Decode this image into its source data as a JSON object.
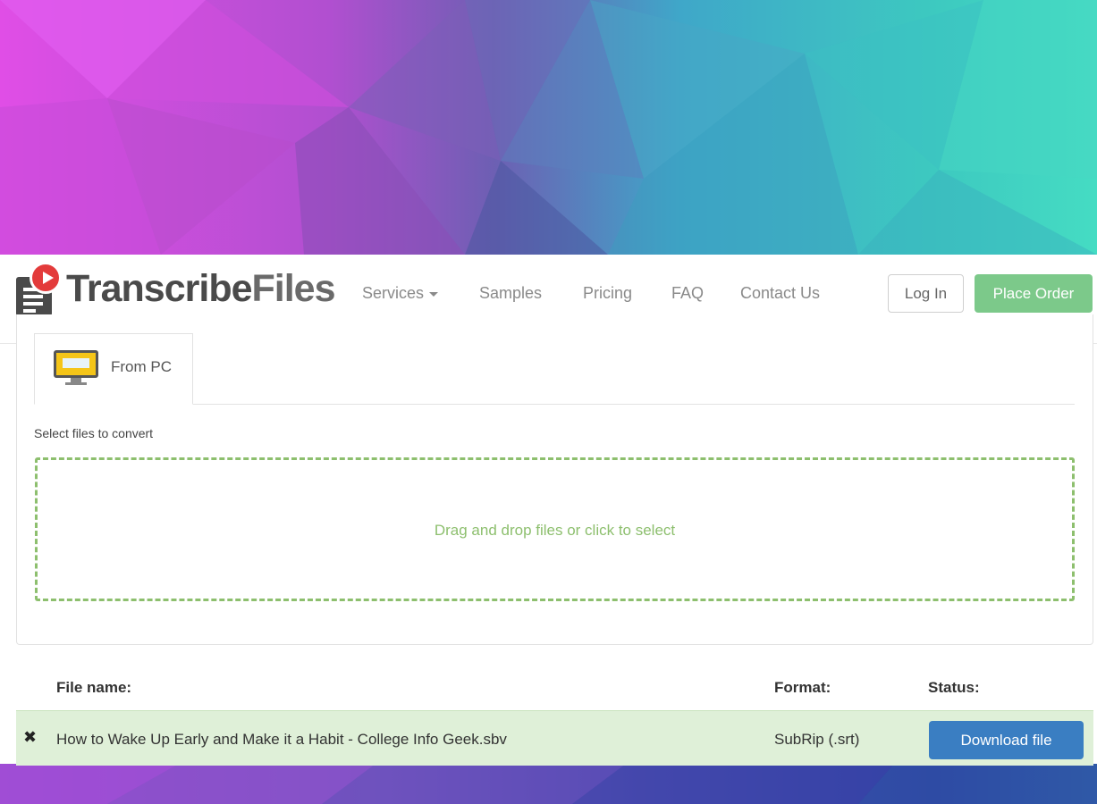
{
  "brand": {
    "name_part1": "Transcribe",
    "name_part2": "Files"
  },
  "nav": {
    "services": "Services",
    "samples": "Samples",
    "pricing": "Pricing",
    "faq": "FAQ",
    "contact": "Contact Us",
    "login": "Log In",
    "place_order": "Place Order"
  },
  "upload": {
    "tab_label": "From PC",
    "select_label": "Select files to convert",
    "dropzone_text": "Drag and drop files or click to select"
  },
  "files_table": {
    "headers": {
      "file_name": "File name:",
      "format": "Format:",
      "status": "Status:"
    },
    "rows": [
      {
        "file_name": "How to Wake Up Early and Make it a Habit - College Info Geek.sbv",
        "format": "SubRip (.srt)",
        "status_button": "Download file"
      }
    ]
  },
  "colors": {
    "order_button": "#7cc98a",
    "download_button": "#3a7ec2",
    "dropzone_accent": "#8dbf6e",
    "row_highlight": "#dff0d8"
  }
}
